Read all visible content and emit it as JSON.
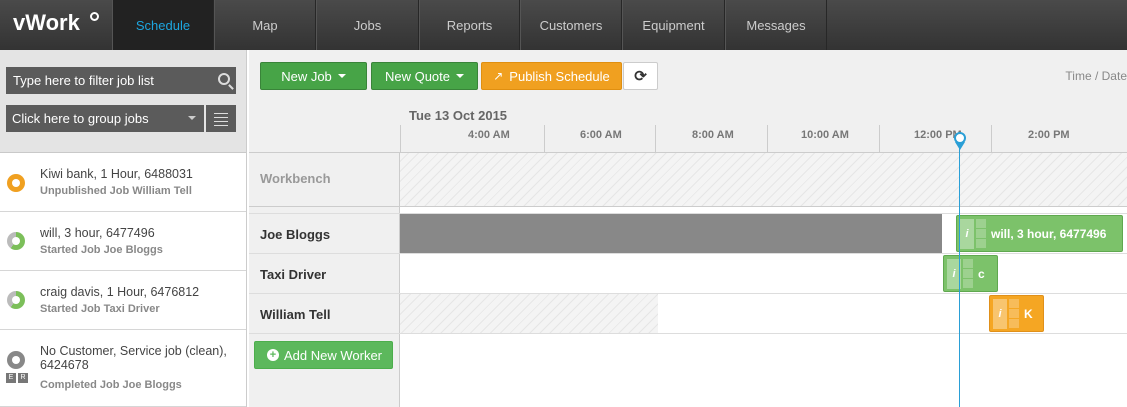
{
  "app": {
    "logo": "vWork"
  },
  "nav": {
    "tabs": [
      "Schedule",
      "Map",
      "Jobs",
      "Reports",
      "Customers",
      "Equipment",
      "Messages"
    ]
  },
  "sidebar": {
    "filter_placeholder": "Type here to filter job list",
    "group_label": "Click here to group jobs",
    "jobs": [
      {
        "title": "Kiwi bank, 1 Hour, 6488031",
        "status": "Unpublished Job William Tell",
        "color": "#f0a020"
      },
      {
        "title": "will, 3 hour, 6477496",
        "status": "Started Job Joe Bloggs",
        "color": "#7cbf5a"
      },
      {
        "title": "craig davis, 1 Hour, 6476812",
        "status": "Started Job Taxi Driver",
        "color": "#7cbf5a"
      },
      {
        "title": "No Customer, Service job (clean), 6424678",
        "status": "Completed Job Joe Bloggs",
        "color": "#888888",
        "badges": [
          "E",
          "R"
        ]
      }
    ]
  },
  "toolbar": {
    "new_job": "New Job",
    "new_quote": "New Quote",
    "publish": "Publish Schedule",
    "time_date_label": "Time / Date"
  },
  "timeline": {
    "date": "Tue 13 Oct 2015",
    "hours": [
      "4:00 AM",
      "6:00 AM",
      "8:00 AM",
      "10:00 AM",
      "12:00 PM",
      "2:00 PM"
    ]
  },
  "schedule": {
    "workbench_label": "Workbench",
    "workers": [
      "Joe Bloggs",
      "Taxi Driver",
      "William Tell"
    ],
    "blocks": [
      {
        "label": "will, 3 hour, 6477496",
        "info": "i"
      },
      {
        "label": "c",
        "info": "i"
      },
      {
        "label": "K",
        "info": "i"
      }
    ],
    "add_worker": "Add New Worker"
  },
  "colors": {
    "accent": "#1da6e0",
    "green": "#47a447",
    "orange": "#f0a020",
    "now_line": "#2a9fd6"
  }
}
